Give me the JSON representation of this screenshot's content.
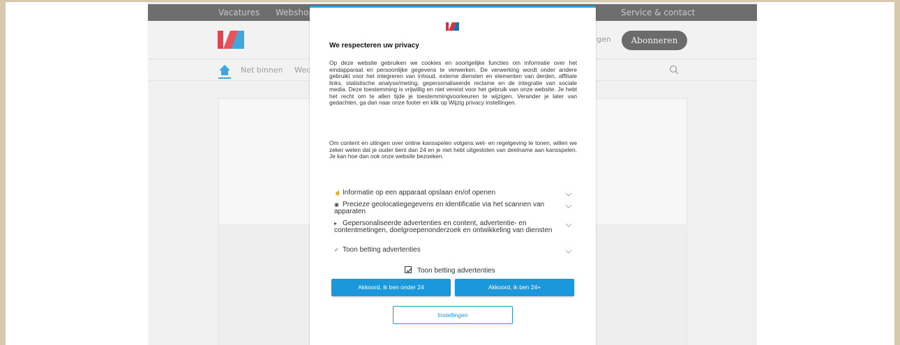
{
  "topbar": {
    "items": [
      "Vacatures",
      "Webshop",
      "Service & contact"
    ]
  },
  "header": {
    "login_label": "ggen",
    "subscribe_label": "Abonneren"
  },
  "nav": {
    "items": [
      "Net binnen",
      "Wed"
    ]
  },
  "modal": {
    "title": "We respecteren uw privacy",
    "paragraph1": "Op deze website gebruiken we cookies en soortgelijke functies om informatie over het eindapparaat en persoonlijke gegevens te verwerken. De verwerking wordt onder andere gebruikt voor het integreren van inhoud, externe diensten en elementen van derden, affiliate links, statistische analyse/meting, gepersonaliseerde reclame en de integratie van sociale media. Deze toestemming is vrijwillig en niet vereist voor het gebruik van onze website. Je hebt het recht om te allen tijde je toestemmingvoorkeuren te wijzigen. Verander je later van gedachten, ga dan naar onze footer en klik op Wijzig privacy instellingen.",
    "paragraph2": "Om content en uitingen over online kansspelen volgens wet- en regelgeving te tonen, willen we zeker weten dat je ouder bent dan 24 en je niet hebt uitgesloten van deelname aan kansspelen. Je kan hoe dan ook onze website bezoeken.",
    "purposes": [
      {
        "icon": "fingerprint-icon",
        "label": "Informatie op een apparaat opslaan en/of openen"
      },
      {
        "icon": "location-pin-icon",
        "label": "Precieze geolocatiegegevens en identificatie via het scannen van apparaten"
      },
      {
        "icon": "megaphone-icon",
        "label": "Gepersonaliseerde advertenties en content, advertentie- en contentmetingen, doelgroepenonderzoek en ontwikkeling van diensten"
      },
      {
        "icon": "check-circle-icon",
        "label": "Toon betting advertenties"
      }
    ],
    "checkbox_label": "Toon betting advertenties",
    "checkbox_checked": true,
    "btn_under": "Akkoord, ik ben onder 24",
    "btn_over": "Akkoord, ik ben 24+",
    "btn_settings": "Instellingen"
  },
  "colors": {
    "accent": "#1a98db",
    "brand_red": "#e2444f",
    "brand_blue": "#3fa6de",
    "topbar": "#6e6e6e"
  }
}
